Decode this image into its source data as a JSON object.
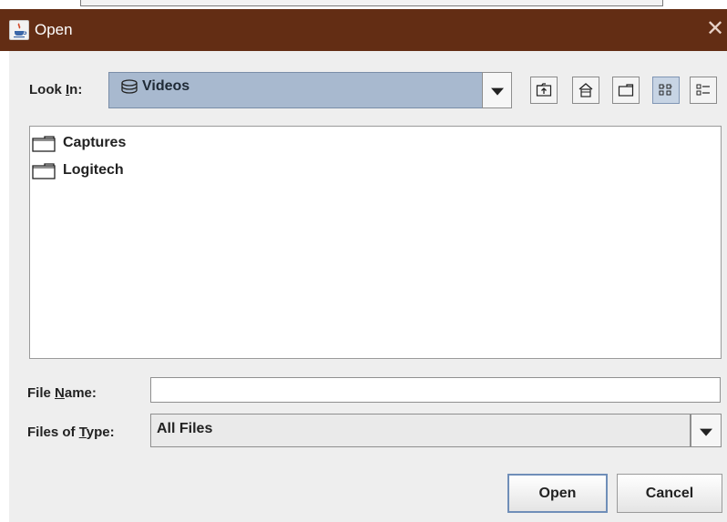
{
  "window": {
    "title": "Open",
    "close_symbol": "✕"
  },
  "lookin": {
    "label_pre": "Look ",
    "label_u": "I",
    "label_post": "n:",
    "value": "Videos",
    "value_icon": "drive-icon"
  },
  "toolbar": {
    "buttons": [
      {
        "name": "up-one-level-button",
        "icon": "up-folder-icon",
        "active": false
      },
      {
        "name": "home-button",
        "icon": "home-icon",
        "active": false
      },
      {
        "name": "new-folder-button",
        "icon": "new-folder-icon",
        "active": false
      },
      {
        "name": "list-view-button",
        "icon": "list-view-icon",
        "active": true
      },
      {
        "name": "details-view-button",
        "icon": "details-view-icon",
        "active": false
      }
    ]
  },
  "files": [
    {
      "name": "Captures",
      "icon": "folder-icon"
    },
    {
      "name": "Logitech",
      "icon": "folder-icon"
    }
  ],
  "filename": {
    "label_pre": "File ",
    "label_u": "N",
    "label_post": "ame:",
    "value": "",
    "placeholder": ""
  },
  "filetype": {
    "label_pre": "Files of ",
    "label_u": "T",
    "label_post": "ype:",
    "value": "All Files"
  },
  "actions": {
    "open": "Open",
    "cancel": "Cancel"
  },
  "colors": {
    "titlebar": "#632d14",
    "dialog_bg": "#eeeeee",
    "combo_selected": "#a8b9cf",
    "default_button_border": "#6f8eb8"
  }
}
